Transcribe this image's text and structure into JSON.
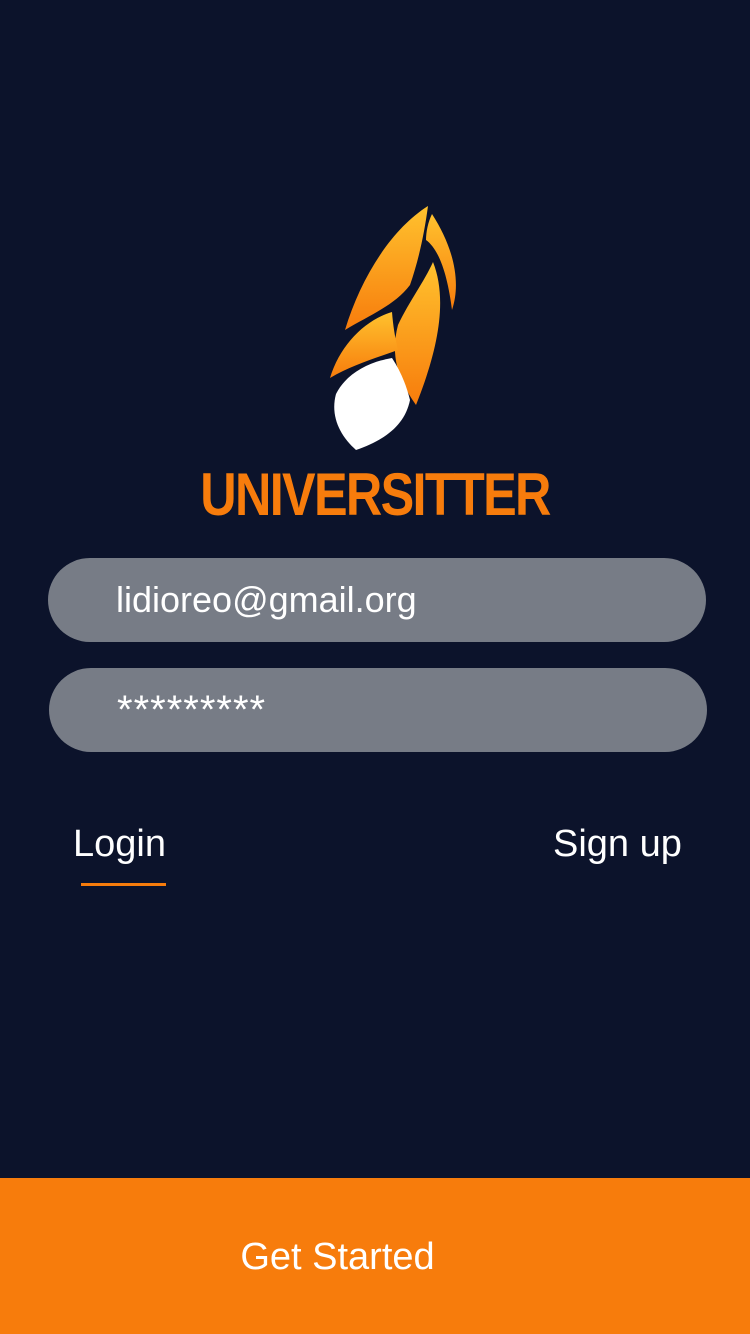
{
  "app": {
    "name": "UNIVERSITTER",
    "logo_icon": "flame-leaf-logo-icon"
  },
  "colors": {
    "background": "#0c132b",
    "accent": "#f77c0c",
    "field_bg": "#777c86",
    "text": "#ffffff"
  },
  "form": {
    "email_value": "lidioreo@gmail.org",
    "password_value": "*********"
  },
  "tabs": {
    "login_label": "Login",
    "signup_label": "Sign up",
    "active": "login"
  },
  "cta": {
    "label": "Get Started"
  }
}
